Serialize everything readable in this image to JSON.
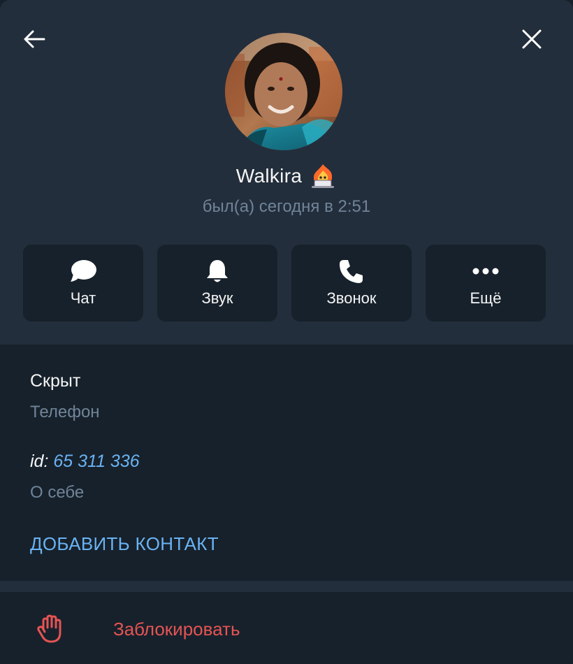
{
  "header": {
    "back_icon": "arrow-left-icon",
    "close_icon": "close-icon"
  },
  "profile": {
    "name": "Walkira",
    "status": "был(а) сегодня в 2:51",
    "name_emoji": "fire-laptop-emoji"
  },
  "actions": [
    {
      "label": "Чат",
      "icon": "chat-bubble-icon"
    },
    {
      "label": "Звук",
      "icon": "bell-icon"
    },
    {
      "label": "Звонок",
      "icon": "phone-icon"
    },
    {
      "label": "Ещё",
      "icon": "more-dots-icon"
    }
  ],
  "info": {
    "phone_value": "Скрыт",
    "phone_label": "Телефон",
    "id_prefix": "id:",
    "id_value": "65 311 336",
    "about_label": "О себе",
    "add_contact": "ДОБАВИТЬ КОНТАКТ"
  },
  "block": {
    "label": "Заблокировать",
    "icon": "hand-stop-icon"
  },
  "colors": {
    "header_bg": "#232e3c",
    "body_bg": "#17212b",
    "accent_blue": "#6ab3f3",
    "danger_red": "#e55454",
    "muted": "#708499"
  }
}
